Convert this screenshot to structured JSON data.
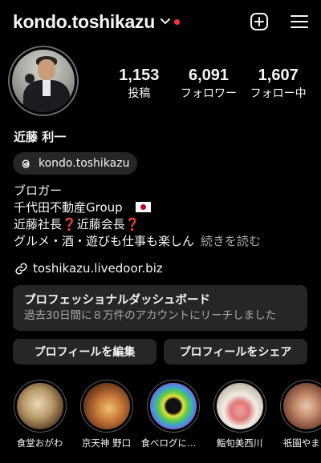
{
  "header": {
    "username": "kondo.toshikazu",
    "notification_color": "#ff3040"
  },
  "profile": {
    "display_name": "近藤 利一",
    "threads_handle": "kondo.toshikazu",
    "stats": [
      {
        "value": "1,153",
        "label": "投稿"
      },
      {
        "value": "6,091",
        "label": "フォロワー"
      },
      {
        "value": "1,607",
        "label": "フォロー中"
      }
    ],
    "bio": {
      "line1": "ブロガー",
      "line2": "千代田不動産Group",
      "line3a": "近藤社長",
      "line3b": "近藤会長",
      "line4": "グルメ・酒・遊びも仕事も楽しん",
      "more": "続きを読む",
      "question_mark": "❓"
    },
    "link": "toshikazu.livedoor.biz"
  },
  "dashboard": {
    "title": "プロフェッショナルダッシュボード",
    "subtitle": "過去30日間に８万件のアカウントにリーチしました"
  },
  "buttons": {
    "edit": "プロフィールを編集",
    "share": "プロフィールをシェア"
  },
  "highlights": [
    {
      "label": "食堂おがわ",
      "icon": "food-thumbnail"
    },
    {
      "label": "京天神 野口",
      "icon": "food-thumbnail"
    },
    {
      "label": "食べログに掲載",
      "icon": "rainbow-logo-thumbnail"
    },
    {
      "label": "鮨旬美西川",
      "icon": "sushi-thumbnail"
    },
    {
      "label": "祇園やまく",
      "icon": "food-thumbnail"
    }
  ]
}
